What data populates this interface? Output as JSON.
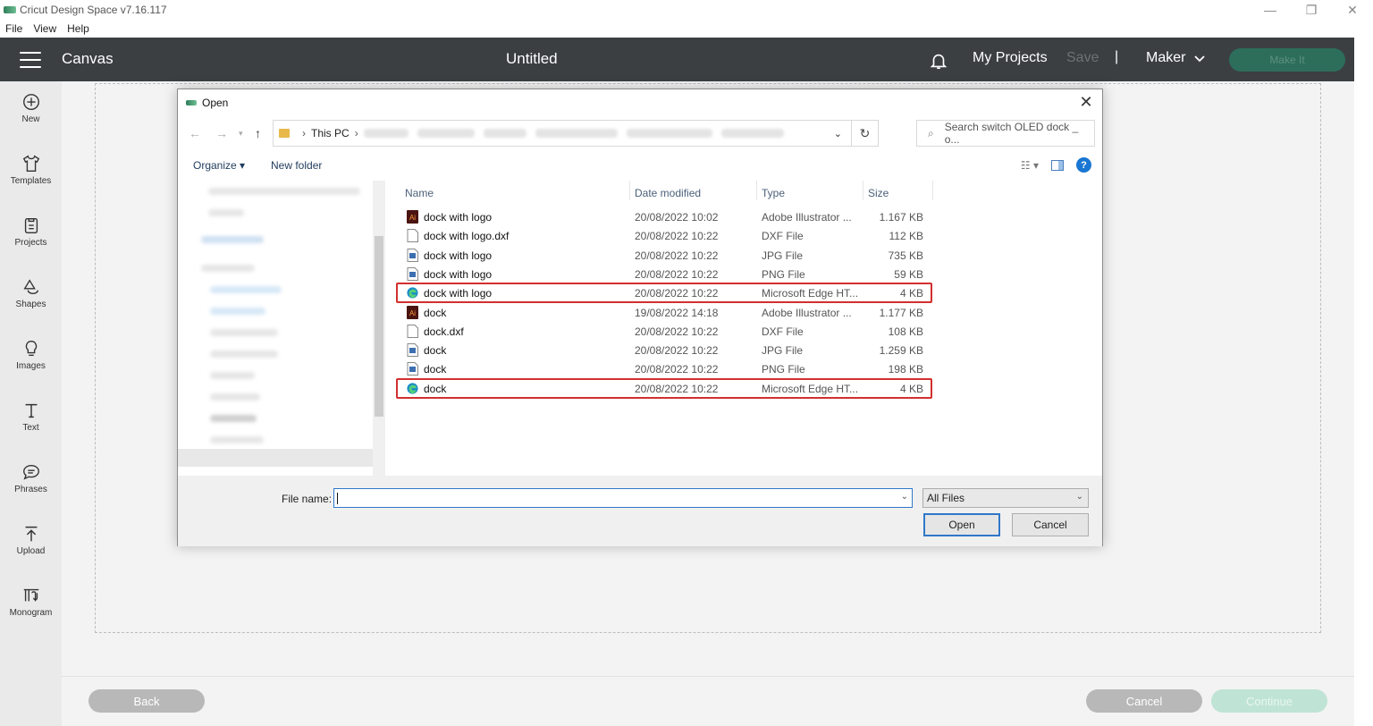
{
  "window": {
    "title": "Cricut Design Space  v7.16.117",
    "controls": [
      "—",
      "❐",
      "✕"
    ]
  },
  "menu": [
    "File",
    "View",
    "Help"
  ],
  "header": {
    "section": "Canvas",
    "doc_title": "Untitled",
    "my_projects": "My Projects",
    "save": "Save",
    "separator": "|",
    "machine": "Maker",
    "make_it": "Make It"
  },
  "sidebar": [
    {
      "label": "New",
      "icon": "plus-circle-icon"
    },
    {
      "label": "Templates",
      "icon": "shirt-icon"
    },
    {
      "label": "Projects",
      "icon": "clipboard-icon"
    },
    {
      "label": "Shapes",
      "icon": "shapes-icon"
    },
    {
      "label": "Images",
      "icon": "lightbulb-icon"
    },
    {
      "label": "Text",
      "icon": "text-icon"
    },
    {
      "label": "Phrases",
      "icon": "speech-bubble-icon"
    },
    {
      "label": "Upload",
      "icon": "upload-icon"
    },
    {
      "label": "Monogram",
      "icon": "monogram-icon"
    }
  ],
  "footer": {
    "back": "Back",
    "cancel": "Cancel",
    "continue": "Continue"
  },
  "dialog": {
    "title": "Open",
    "breadcrumb_root": "This PC",
    "search_placeholder": "Search switch OLED dock _ o...",
    "organize": "Organize",
    "new_folder": "New folder",
    "columns": {
      "name": "Name",
      "date": "Date modified",
      "type": "Type",
      "size": "Size"
    },
    "files": [
      {
        "name": "dock with logo",
        "date": "20/08/2022 10:02",
        "type": "Adobe Illustrator ...",
        "size": "1.167 KB",
        "icon": "ai"
      },
      {
        "name": "dock with logo.dxf",
        "date": "20/08/2022 10:22",
        "type": "DXF File",
        "size": "112 KB",
        "icon": "blank"
      },
      {
        "name": "dock with logo",
        "date": "20/08/2022 10:22",
        "type": "JPG File",
        "size": "735 KB",
        "icon": "image"
      },
      {
        "name": "dock with logo",
        "date": "20/08/2022 10:22",
        "type": "PNG File",
        "size": "59 KB",
        "icon": "image"
      },
      {
        "name": "dock with logo",
        "date": "20/08/2022 10:22",
        "type": "Microsoft Edge HT...",
        "size": "4 KB",
        "icon": "edge",
        "highlighted": true
      },
      {
        "name": "dock",
        "date": "19/08/2022 14:18",
        "type": "Adobe Illustrator ...",
        "size": "1.177 KB",
        "icon": "ai"
      },
      {
        "name": "dock.dxf",
        "date": "20/08/2022 10:22",
        "type": "DXF File",
        "size": "108 KB",
        "icon": "blank"
      },
      {
        "name": "dock",
        "date": "20/08/2022 10:22",
        "type": "JPG File",
        "size": "1.259 KB",
        "icon": "image"
      },
      {
        "name": "dock",
        "date": "20/08/2022 10:22",
        "type": "PNG File",
        "size": "198 KB",
        "icon": "image"
      },
      {
        "name": "dock",
        "date": "20/08/2022 10:22",
        "type": "Microsoft Edge HT...",
        "size": "4 KB",
        "icon": "edge",
        "highlighted": true
      }
    ],
    "file_name_label": "File name:",
    "file_name_value": "",
    "filter": "All Files",
    "open_btn": "Open",
    "cancel_btn": "Cancel"
  },
  "colors": {
    "header_bg": "#3b3f42",
    "make_it_bg": "#2d6e5a",
    "highlight": "#d32f2f",
    "accent_blue": "#2f78c8"
  }
}
